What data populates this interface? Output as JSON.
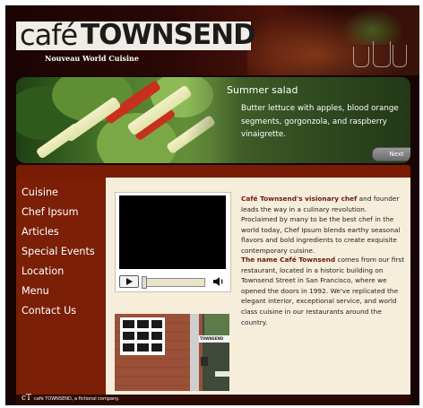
{
  "header": {
    "logo_cafe": "café",
    "logo_townsend": "TOWNSEND",
    "tagline": "Nouveau World Cuisine"
  },
  "feature": {
    "title": "Summer salad",
    "description": "Butter lettuce with apples, blood orange segments, gorgonzola, and raspberry vinaigrette.",
    "next_label": "Next"
  },
  "nav": {
    "items": [
      "Cuisine",
      "Chef Ipsum",
      "Articles",
      "Special Events",
      "Location",
      "Menu",
      "Contact Us"
    ]
  },
  "video": {
    "play_icon": "play-icon",
    "volume_icon": "volume-icon",
    "progress": 0
  },
  "article": {
    "p1_lead": "Café Townsend's visionary chef",
    "p1_text": " and founder leads the way in a culinary revolution. Proclaimed by many to be the best chef in the world today, Chef Ipsum blends earthy seasonal flavors and bold ingredients to create exquisite contemporary cuisine.",
    "p2_lead": "The name Café Townsend",
    "p2_text": " comes from our first restaurant, located in a historic building on Townsend Street in San Francisco, where we opened the doors in 1992. We've replicated the elegant interior, exceptional service, and world class cuisine in our restaurants around the country."
  },
  "photo": {
    "street_sign": "TOWNSEND"
  },
  "footer": {
    "mark": "cT",
    "text": "café TOWNSEND, a fictional company."
  },
  "colors": {
    "sidebar": "#7b1f06",
    "content_bg": "#f6eddb",
    "accent_text": "#6b1a0a"
  }
}
